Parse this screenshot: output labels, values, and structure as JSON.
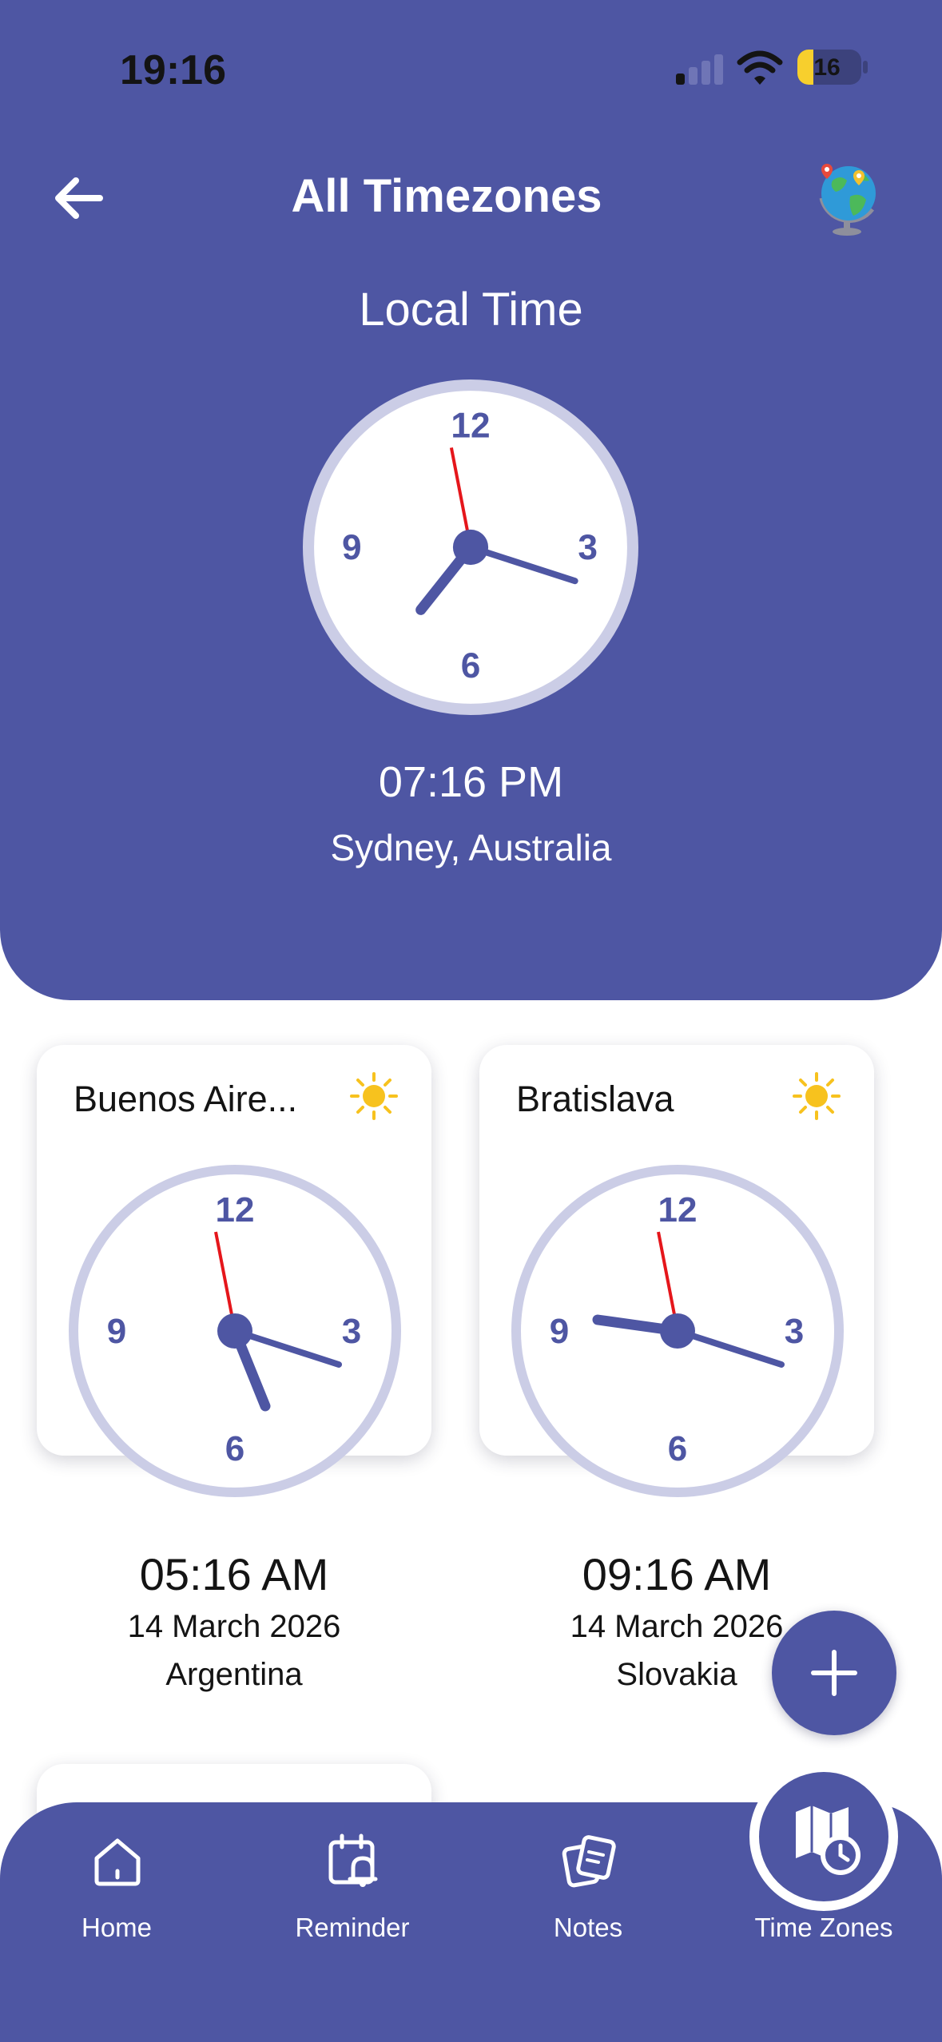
{
  "status_bar": {
    "time": "19:16",
    "battery": "16"
  },
  "header": {
    "title": "All Timezones",
    "back_icon": "arrow-left-icon",
    "globe_icon": "globe-icon"
  },
  "local": {
    "label": "Local Time",
    "time": "07:16 PM",
    "location": "Sydney, Australia",
    "clock_numbers": [
      "12",
      "3",
      "6",
      "9"
    ]
  },
  "cards": [
    {
      "city": "Buenos Aire...",
      "icon": "sun-icon",
      "time": "05:16 AM",
      "date": "14 March 2026",
      "country": "Argentina",
      "clock_numbers": [
        "12",
        "3",
        "6",
        "9"
      ]
    },
    {
      "city": "Bratislava",
      "icon": "sun-icon",
      "time": "09:16 AM",
      "date": "14 March 2026",
      "country": "Slovakia",
      "clock_numbers": [
        "12",
        "3",
        "6",
        "9"
      ]
    }
  ],
  "fab": {
    "icon": "plus-icon"
  },
  "nav": {
    "items": [
      {
        "label": "Home",
        "icon": "home-icon"
      },
      {
        "label": "Reminder",
        "icon": "calendar-bell-icon"
      },
      {
        "label": "Notes",
        "icon": "notes-icon"
      },
      {
        "label": "Time Zones",
        "icon": "map-clock-icon",
        "active": true
      }
    ]
  },
  "colors": {
    "primary": "#4e56a3",
    "clock_ring": "#cbcde6",
    "second_hand": "#e5161b",
    "sun": "#f7c21e",
    "text_dark": "#141414"
  }
}
